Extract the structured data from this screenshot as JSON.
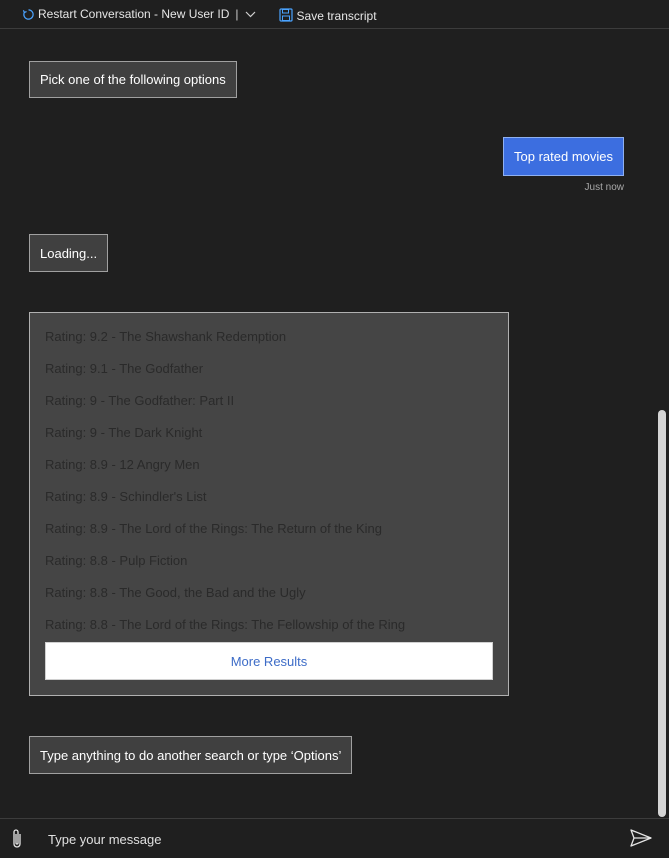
{
  "toolbar": {
    "restart_label": "Restart Conversation - New User ID",
    "separator": "|",
    "save_label": "Save transcript"
  },
  "messages": {
    "bot_prompt": "Pick one of the following options",
    "user_choice": "Top rated movies",
    "user_timestamp": "Just now",
    "bot_loading": "Loading...",
    "bot_followup": "Type anything to do another search or type ‘Options’"
  },
  "results": {
    "items": [
      "Rating: 9.2 - The Shawshank Redemption",
      "Rating: 9.1 - The Godfather",
      "Rating: 9 - The Godfather: Part II",
      "Rating: 9 - The Dark Knight",
      "Rating: 8.9 - 12 Angry Men",
      "Rating: 8.9 - Schindler's List",
      "Rating: 8.9 - The Lord of the Rings: The Return of the King",
      "Rating: 8.8 - Pulp Fiction",
      "Rating: 8.8 - The Good, the Bad and the Ugly",
      "Rating: 8.8 - The Lord of the Rings: The Fellowship of the Ring"
    ],
    "more_label": "More Results"
  },
  "sendbox": {
    "placeholder": "Type your message",
    "value": ""
  },
  "colors": {
    "background": "#1f1f1f",
    "bot_bubble": "#404040",
    "user_bubble": "#3c6ee0",
    "card_bg": "#454545",
    "link_blue": "#3d6cc7",
    "icon_blue": "#4aa3ff"
  }
}
